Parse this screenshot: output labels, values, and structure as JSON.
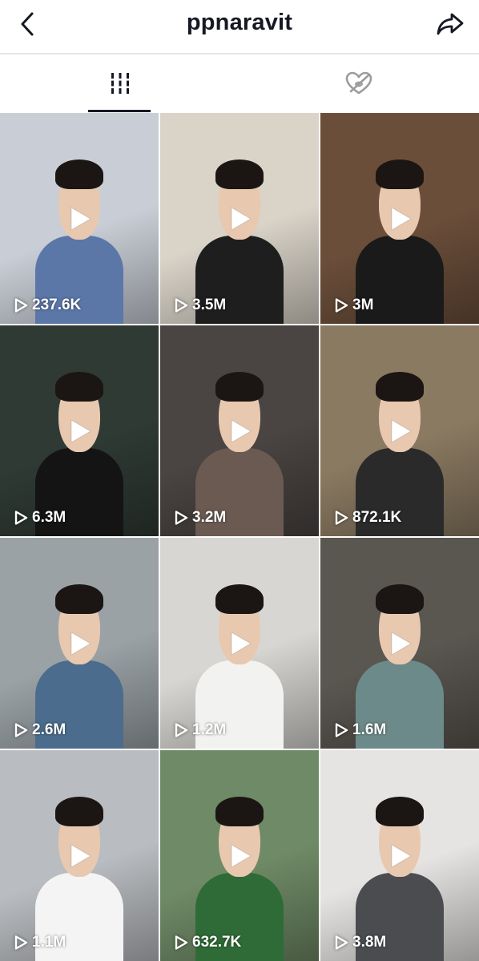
{
  "header": {
    "title": "ppnaravit",
    "back_icon": "chevron-left-icon",
    "share_icon": "share-arrow-icon"
  },
  "tabs": [
    {
      "name": "videos",
      "icon": "grid-bars-icon",
      "active": true
    },
    {
      "name": "liked",
      "icon": "heart-hidden-icon",
      "active": false
    }
  ],
  "colors": {
    "text": "#161823",
    "divider": "#e6e6e8",
    "overlay_text": "#ffffff"
  },
  "videos": [
    {
      "views": "237.6K",
      "bg": "#c9ced6",
      "accent": "#5b77a8"
    },
    {
      "views": "3.5M",
      "bg": "#d9d3c8",
      "accent": "#1e1e1e"
    },
    {
      "views": "3M",
      "bg": "#6b4e3a",
      "accent": "#1a1a1a"
    },
    {
      "views": "6.3M",
      "bg": "#2f3a34",
      "accent": "#141414"
    },
    {
      "views": "3.2M",
      "bg": "#4a4442",
      "accent": "#6a5a52"
    },
    {
      "views": "872.1K",
      "bg": "#8b7a62",
      "accent": "#2a2a2a"
    },
    {
      "views": "2.6M",
      "bg": "#9aa2a6",
      "accent": "#4b6c8c"
    },
    {
      "views": "1.2M",
      "bg": "#d8d6d2",
      "accent": "#f2f2f0"
    },
    {
      "views": "1.6M",
      "bg": "#5a5650",
      "accent": "#6d8a8a"
    },
    {
      "views": "1.1M",
      "bg": "#b9bcc0",
      "accent": "#f4f4f4"
    },
    {
      "views": "632.7K",
      "bg": "#6f8a66",
      "accent": "#2f6b36"
    },
    {
      "views": "3.8M",
      "bg": "#e6e4e2",
      "accent": "#4a4c50"
    }
  ]
}
